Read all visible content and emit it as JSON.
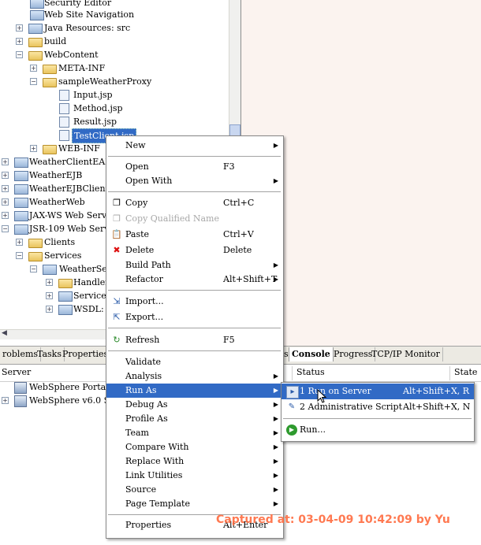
{
  "tree": {
    "rows": [
      {
        "label": "Security Editor",
        "icon": "security-icon"
      },
      {
        "label": "Web Site Navigation",
        "icon": "sitemap-icon"
      },
      {
        "label": "Java Resources: src",
        "icon": "java-resources-icon"
      },
      {
        "label": "build",
        "icon": "folder-icon"
      },
      {
        "label": "WebContent",
        "icon": "folder-icon"
      },
      {
        "label": "META-INF",
        "icon": "folder-icon"
      },
      {
        "label": "sampleWeatherProxy",
        "icon": "folder-icon"
      },
      {
        "label": "Input.jsp",
        "icon": "jsp-file-icon"
      },
      {
        "label": "Method.jsp",
        "icon": "jsp-file-icon"
      },
      {
        "label": "Result.jsp",
        "icon": "jsp-file-icon"
      },
      {
        "label": "TestClient.jsp",
        "icon": "jsp-file-icon"
      },
      {
        "label": "WEB-INF",
        "icon": "folder-icon"
      },
      {
        "label": "WeatherClientEAR",
        "icon": "ear-project-icon"
      },
      {
        "label": "WeatherEJB",
        "icon": "ejb-project-icon"
      },
      {
        "label": "WeatherEJBClient",
        "icon": "ejb-project-icon"
      },
      {
        "label": "WeatherWeb",
        "icon": "web-project-icon"
      },
      {
        "label": "JAX-WS Web Servic",
        "icon": "webservice-icon"
      },
      {
        "label": "JSR-109 Web Servic",
        "icon": "webservice-icon"
      },
      {
        "label": "Clients",
        "icon": "folder-icon"
      },
      {
        "label": "Services",
        "icon": "folder-icon"
      },
      {
        "label": "WeatherServ",
        "icon": "service-icon"
      },
      {
        "label": "Handlers",
        "icon": "folder-icon"
      },
      {
        "label": "Service C",
        "icon": "service-icon"
      },
      {
        "label": "WSDL: /",
        "icon": "wsdl-icon"
      }
    ]
  },
  "tabs_left": [
    "roblems",
    "Tasks",
    "Properties"
  ],
  "tabs_right": [
    {
      "label": "s",
      "active": false
    },
    {
      "label": "Console",
      "active": true
    },
    {
      "label": "Progress",
      "active": false
    },
    {
      "label": "TCP/IP Monitor",
      "active": false
    }
  ],
  "servers": {
    "col_server": "Server",
    "col_status": "Status",
    "col_state": "State",
    "rows": [
      {
        "label": "WebSphere Portal v6"
      },
      {
        "label": "WebSphere v6.0 Ser"
      }
    ]
  },
  "context_menu": {
    "items": [
      {
        "label": "New",
        "accel": "",
        "submenu": true
      },
      {
        "label": "Open",
        "accel": "F3",
        "submenu": false
      },
      {
        "label": "Open With",
        "accel": "",
        "submenu": true
      },
      {
        "label": "Copy",
        "accel": "Ctrl+C",
        "submenu": false,
        "icon": "copy-icon"
      },
      {
        "label": "Copy Qualified Name",
        "accel": "",
        "submenu": false,
        "disabled": true,
        "icon": "copy-qualified-icon"
      },
      {
        "label": "Paste",
        "accel": "Ctrl+V",
        "submenu": false,
        "icon": "paste-icon"
      },
      {
        "label": "Delete",
        "accel": "Delete",
        "submenu": false,
        "icon": "delete-icon"
      },
      {
        "label": "Build Path",
        "accel": "",
        "submenu": true
      },
      {
        "label": "Refactor",
        "accel": "Alt+Shift+T",
        "submenu": true
      },
      {
        "label": "Import...",
        "accel": "",
        "submenu": false,
        "icon": "import-icon"
      },
      {
        "label": "Export...",
        "accel": "",
        "submenu": false,
        "icon": "export-icon"
      },
      {
        "label": "Refresh",
        "accel": "F5",
        "submenu": false,
        "icon": "refresh-icon"
      },
      {
        "label": "Validate",
        "accel": "",
        "submenu": false
      },
      {
        "label": "Analysis",
        "accel": "",
        "submenu": true
      },
      {
        "label": "Run As",
        "accel": "",
        "submenu": true,
        "highlighted": true
      },
      {
        "label": "Debug As",
        "accel": "",
        "submenu": true
      },
      {
        "label": "Profile As",
        "accel": "",
        "submenu": true
      },
      {
        "label": "Team",
        "accel": "",
        "submenu": true
      },
      {
        "label": "Compare With",
        "accel": "",
        "submenu": true
      },
      {
        "label": "Replace With",
        "accel": "",
        "submenu": true
      },
      {
        "label": "Link Utilities",
        "accel": "",
        "submenu": true
      },
      {
        "label": "Source",
        "accel": "",
        "submenu": true
      },
      {
        "label": "Page Template",
        "accel": "",
        "submenu": true
      },
      {
        "label": "Properties",
        "accel": "Alt+Enter",
        "submenu": false
      }
    ]
  },
  "run_as_submenu": {
    "items": [
      {
        "label": "1 Run on Server",
        "accel": "Alt+Shift+X, R",
        "highlighted": true,
        "icon": "run-on-server-icon"
      },
      {
        "label": "2 Administrative Script",
        "accel": "Alt+Shift+X, N",
        "icon": "admin-script-icon"
      },
      {
        "label": "Run...",
        "accel": "",
        "icon": "run-icon"
      }
    ]
  },
  "watermark": "Captured at: 03-04-09 10:42:09 by Yu",
  "colors": {
    "selection": "#316ac5",
    "editor_bg": "#fbf3ef",
    "watermark": "#ff6b3f"
  }
}
